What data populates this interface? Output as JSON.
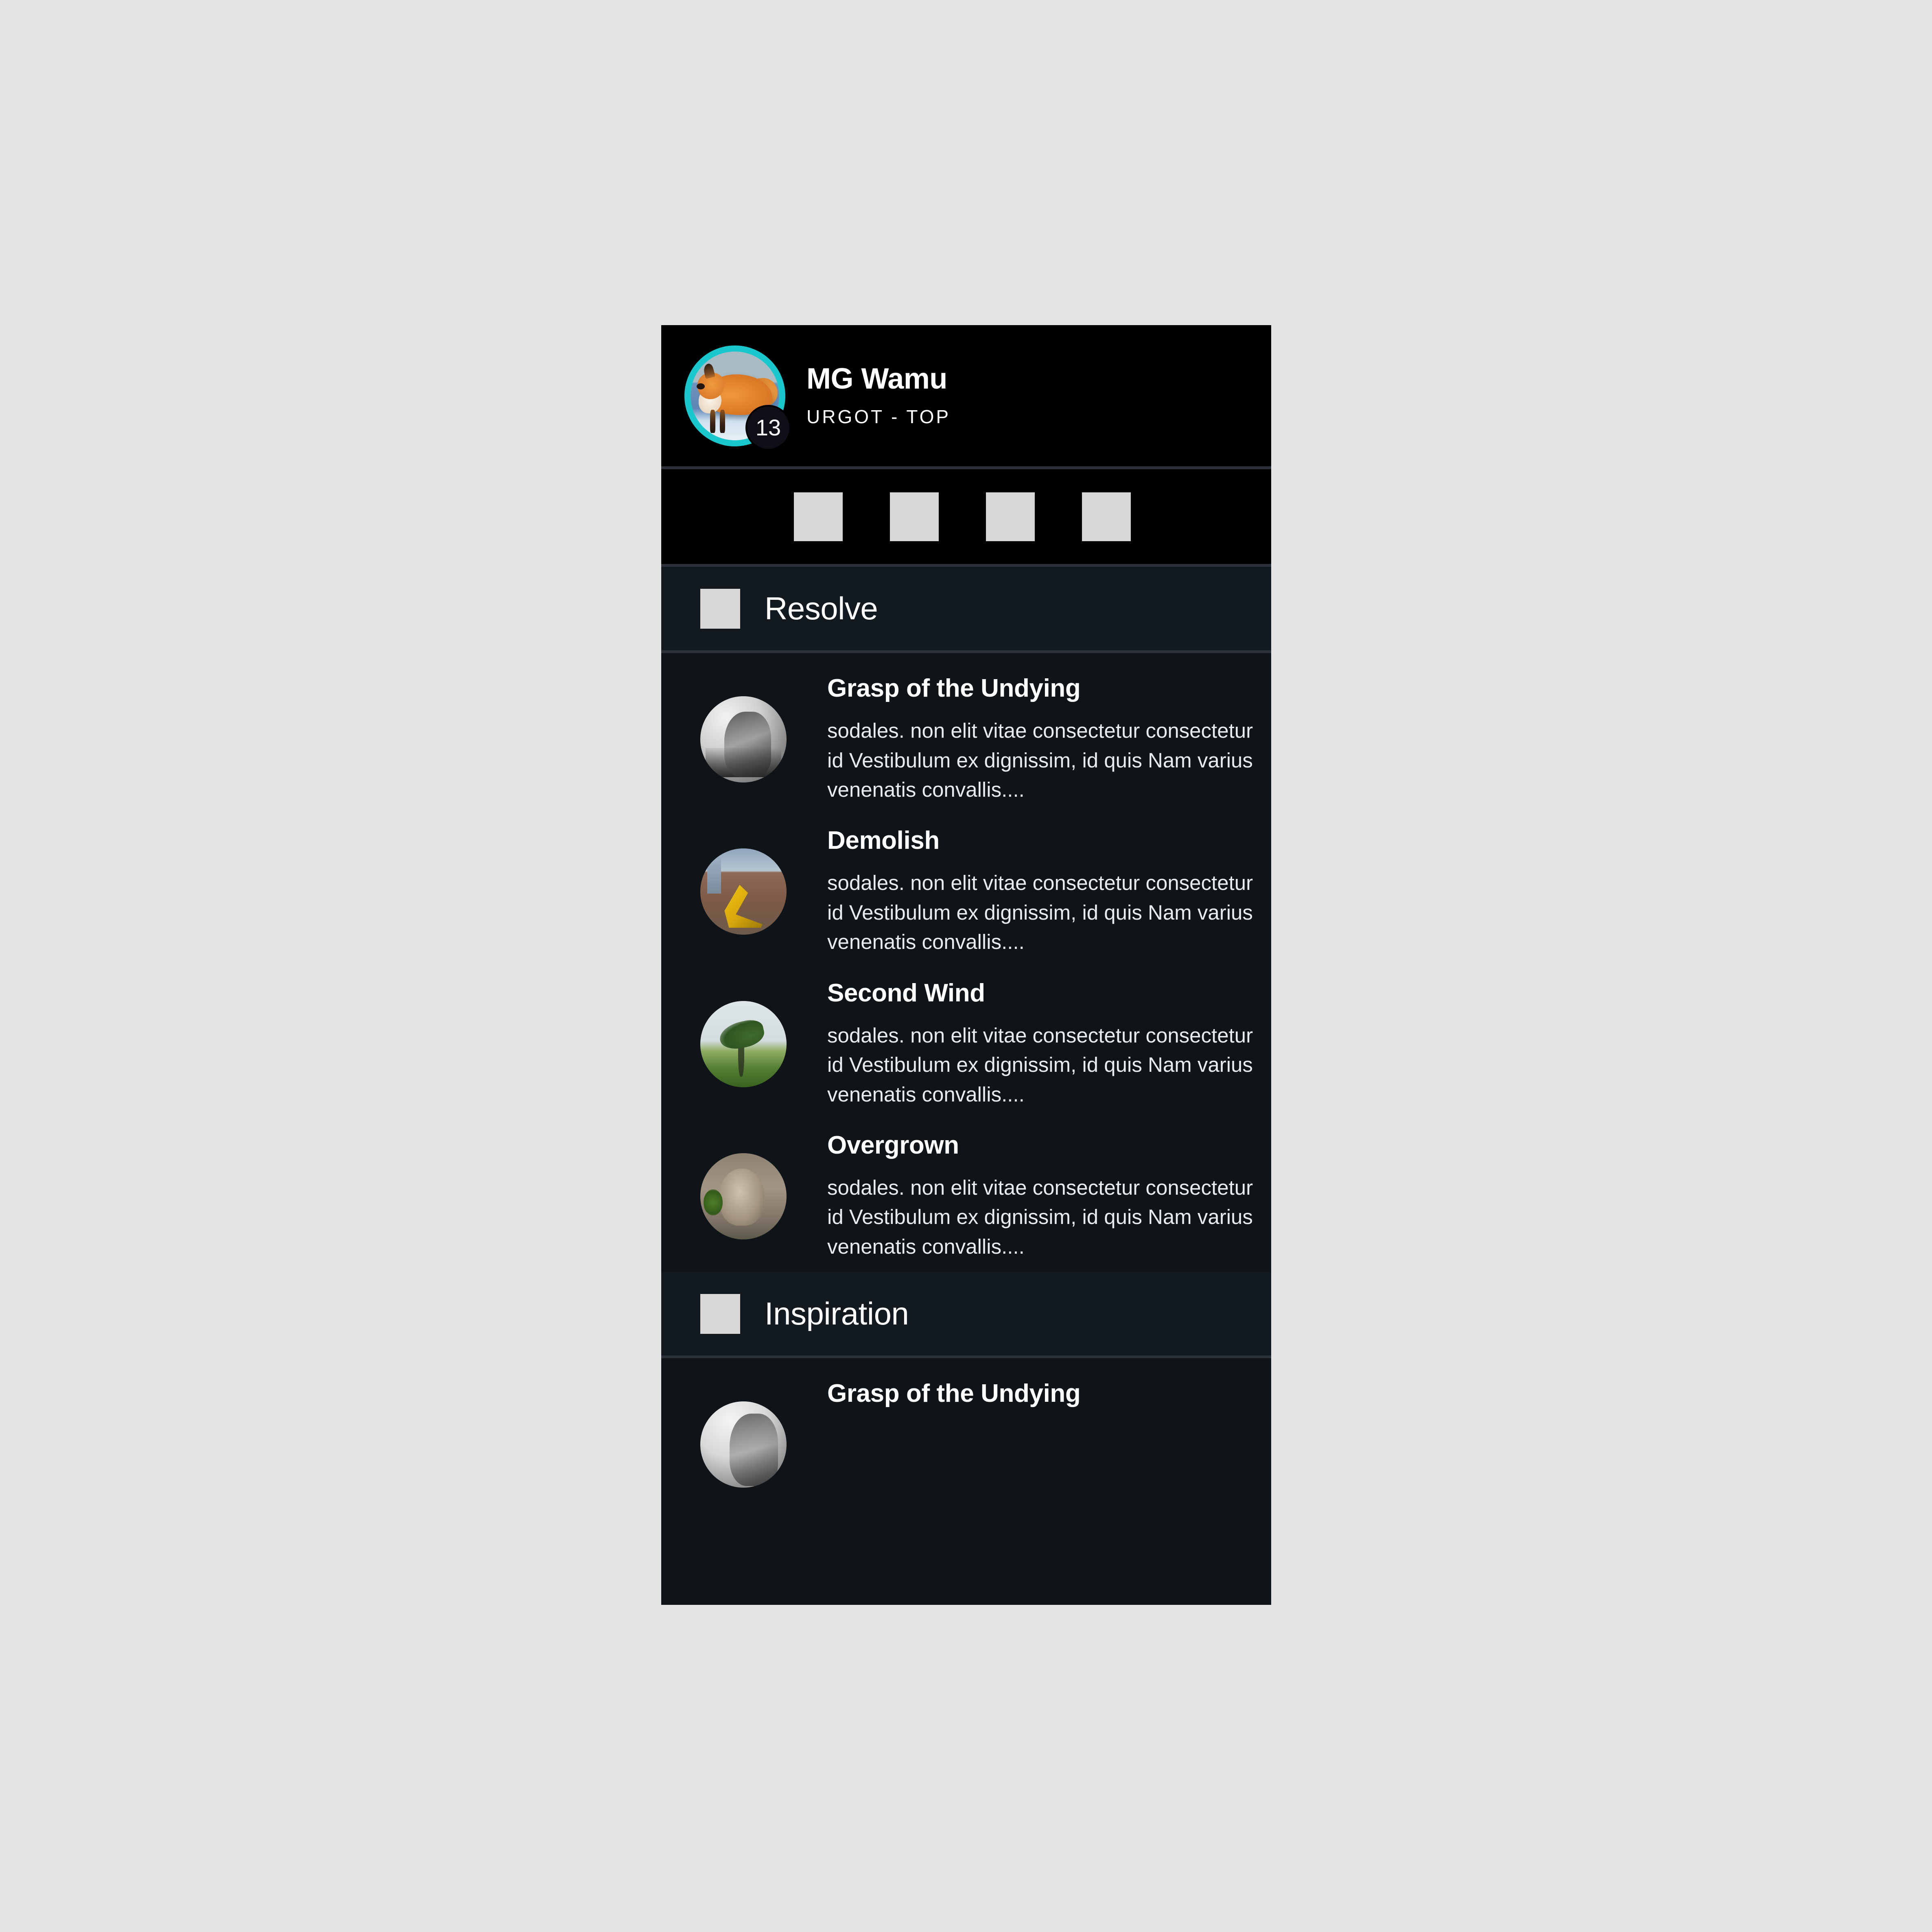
{
  "profile": {
    "name": "MG Wamu",
    "subtitle": "URGOT  -  TOP",
    "level_badge": "13",
    "avatar_icon": "fox-avatar-photo",
    "ring_color": "#18c8cd",
    "badge_bg": "#100e16"
  },
  "stat_strip": {
    "items": [
      {
        "icon": "stat-placeholder-1"
      },
      {
        "icon": "stat-placeholder-2"
      },
      {
        "icon": "stat-placeholder-3"
      },
      {
        "icon": "stat-placeholder-4"
      }
    ]
  },
  "sections": [
    {
      "title": "Resolve",
      "icon": "rune-tree-icon",
      "runes": [
        {
          "name": "Grasp of the Undying",
          "description": "sodales. non elit vitae consectetur consectetur id Vestibulum ex dignissim, id quis Nam varius venenatis convallis....",
          "thumb": "grasp-of-the-undying-thumb"
        },
        {
          "name": "Demolish",
          "description": "sodales. non elit vitae consectetur consectetur id Vestibulum ex dignissim, id quis Nam varius venenatis convallis....",
          "thumb": "demolish-thumb"
        },
        {
          "name": "Second Wind",
          "description": "sodales. non elit vitae consectetur consectetur id Vestibulum ex dignissim, id quis Nam varius venenatis convallis....",
          "thumb": "second-wind-thumb"
        },
        {
          "name": "Overgrown",
          "description": "sodales. non elit vitae consectetur consectetur id Vestibulum ex dignissim, id quis Nam varius venenatis convallis....",
          "thumb": "overgrown-thumb"
        }
      ]
    },
    {
      "title": "Inspiration",
      "icon": "rune-tree-icon",
      "runes": [
        {
          "name": "Grasp of the Undying",
          "description": "",
          "thumb": "grasp-of-the-undying-thumb"
        }
      ]
    }
  ],
  "theme": {
    "card_bg": "#0e1418",
    "header_bg": "#000000",
    "divider": "#2a3138",
    "placeholder": "#d7d7d7",
    "page_bg": "#e4e4e4",
    "text_primary": "#ffffff",
    "text_secondary": "#e9ecee"
  }
}
